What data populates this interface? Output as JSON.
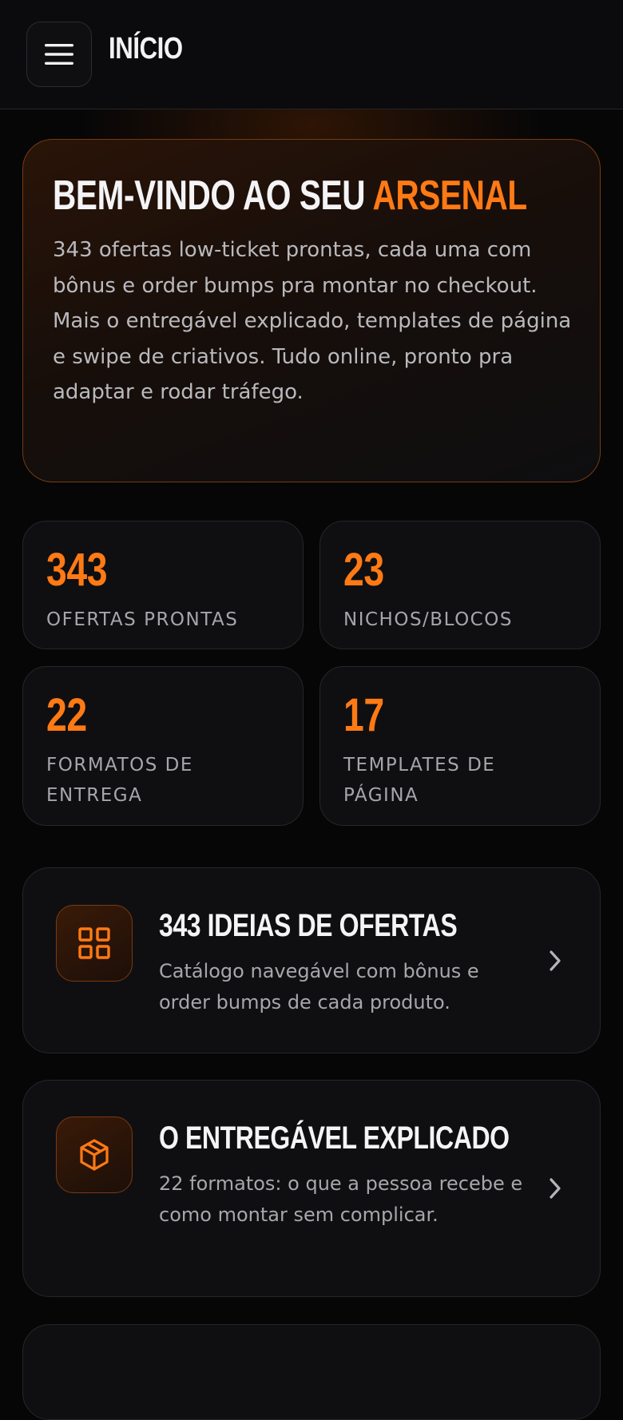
{
  "header": {
    "title": "INÍCIO",
    "menu_icon": "hamburger-menu-icon"
  },
  "hero": {
    "title_prefix": "BEM-VINDO AO SEU ",
    "title_accent": "ARSENAL",
    "description": "343 ofertas low-ticket prontas, cada uma com bônus e order bumps pra montar no checkout. Mais o entregável explicado, templates de página e swipe de criativos. Tudo online, pronto pra adaptar e rodar tráfego."
  },
  "stats": [
    {
      "value": "343",
      "label": "OFERTAS PRONTAS"
    },
    {
      "value": "23",
      "label": "NICHOS/BLOCOS"
    },
    {
      "value": "22",
      "label": "FORMATOS DE ENTREGA"
    },
    {
      "value": "17",
      "label": "TEMPLATES DE PÁGINA"
    }
  ],
  "cards": [
    {
      "title": "343 IDEIAS DE OFERTAS",
      "description": "Catálogo navegável com bônus e order bumps de cada produto.",
      "icon": "grid-icon"
    },
    {
      "title": "O ENTREGÁVEL EXPLICADO",
      "description": "22 formatos: o que a pessoa recebe e como montar sem complicar.",
      "icon": "package-box-icon"
    }
  ],
  "colors": {
    "accent": "#ff7a14",
    "background": "#060607",
    "card": "#0f0f12",
    "border": "#26262a"
  }
}
